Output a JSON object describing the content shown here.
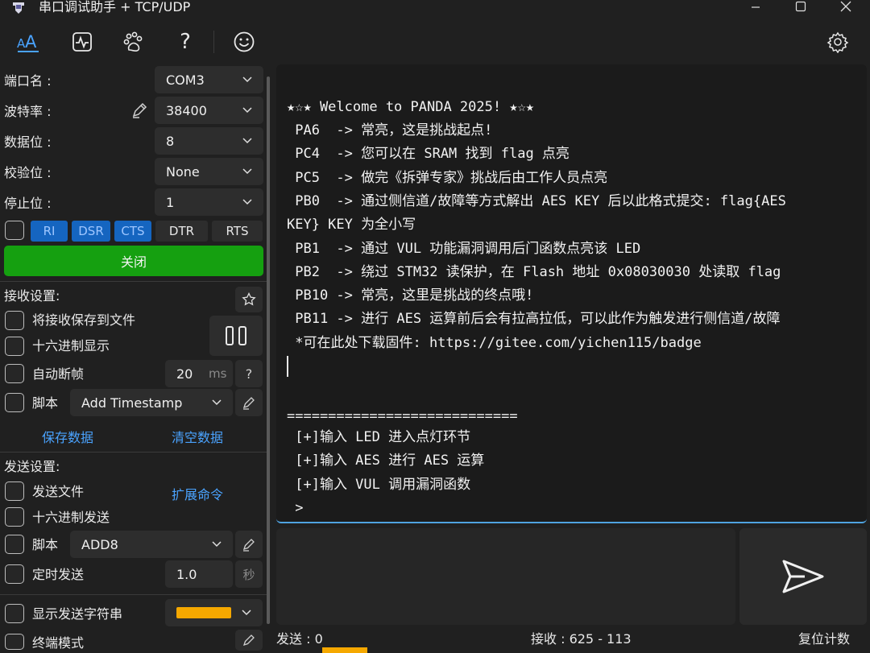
{
  "window": {
    "title": "串口调试助手 + TCP/UDP",
    "controls": [
      "minimize-icon",
      "maximize-icon",
      "close-icon"
    ]
  },
  "toolbar": {
    "icons": [
      "font-size-icon",
      "waveform-icon",
      "paw-icon",
      "help-icon",
      "smiley-icon",
      "gear-icon"
    ],
    "help_glyph": "?",
    "accent": "#4aa3ff"
  },
  "serial": {
    "port_label": "端口名 :",
    "port_value": "COM3",
    "baud_label": "波特率 :",
    "baud_value": "38400",
    "databits_label": "数据位 :",
    "databits_value": "8",
    "parity_label": "校验位 :",
    "parity_value": "None",
    "stopbits_label": "停止位 :",
    "stopbits_value": "1",
    "signals": [
      "RI",
      "DSR",
      "CTS",
      "DTR",
      "RTS"
    ],
    "close_button": "关闭",
    "close_button_color": "#15a010"
  },
  "receive_settings": {
    "title": "接收设置:",
    "save_to_file": "将接收保存到文件",
    "hex_display": "十六进制显示",
    "auto_frame": "自动断帧",
    "auto_frame_value": "20",
    "auto_frame_unit": "ms",
    "auto_frame_help": "?",
    "script_label": "脚本",
    "script_value": "Add Timestamp",
    "save_data": "保存数据",
    "clear_data": "清空数据"
  },
  "send_settings": {
    "title": "发送设置:",
    "send_file": "发送文件",
    "extend_cmd": "扩展命令",
    "hex_send": "十六进制发送",
    "script_label": "脚本",
    "script_value": "ADD8",
    "timed_send": "定时发送",
    "timed_value": "1.0",
    "timed_unit": "秒",
    "show_send_string": "显示发送字符串",
    "show_send_color": "#f5a800",
    "terminal_mode": "终端模式"
  },
  "receive_text": [
    "★☆★ Welcome to PANDA 2025! ★☆★",
    " PA6  -> 常亮，这是挑战起点!",
    " PC4  -> 您可以在 SRAM 找到 flag 点亮",
    " PC5  -> 做完《拆弹专家》挑战后由工作人员点亮",
    " PB0  -> 通过侧信道/故障等方式解出 AES KEY 后以此格式提交: flag{AES",
    "KEY} KEY 为全小写",
    " PB1  -> 通过 VUL 功能漏洞调用后门函数点亮该 LED",
    " PB2  -> 绕过 STM32 读保护，在 Flash 地址 0x08030030 处读取 flag",
    " PB10 -> 常亮，这里是挑战的终点哦!",
    " PB11 -> 进行 AES 运算前后会有拉高拉低，可以此作为触发进行侧信道/故障",
    " *可在此处下载固件: https://gitee.com/yichen115/badge",
    "",
    "",
    "",
    "============================",
    " [+]输入 LED 进入点灯环节",
    " [+]输入 AES 进行 AES 运算",
    " [+]输入 VUL 调用漏洞函数",
    " >"
  ],
  "status": {
    "sent_label": "发送 : 0",
    "received_label": "接收 : 625  -  113",
    "reset_count": "复位计数"
  }
}
